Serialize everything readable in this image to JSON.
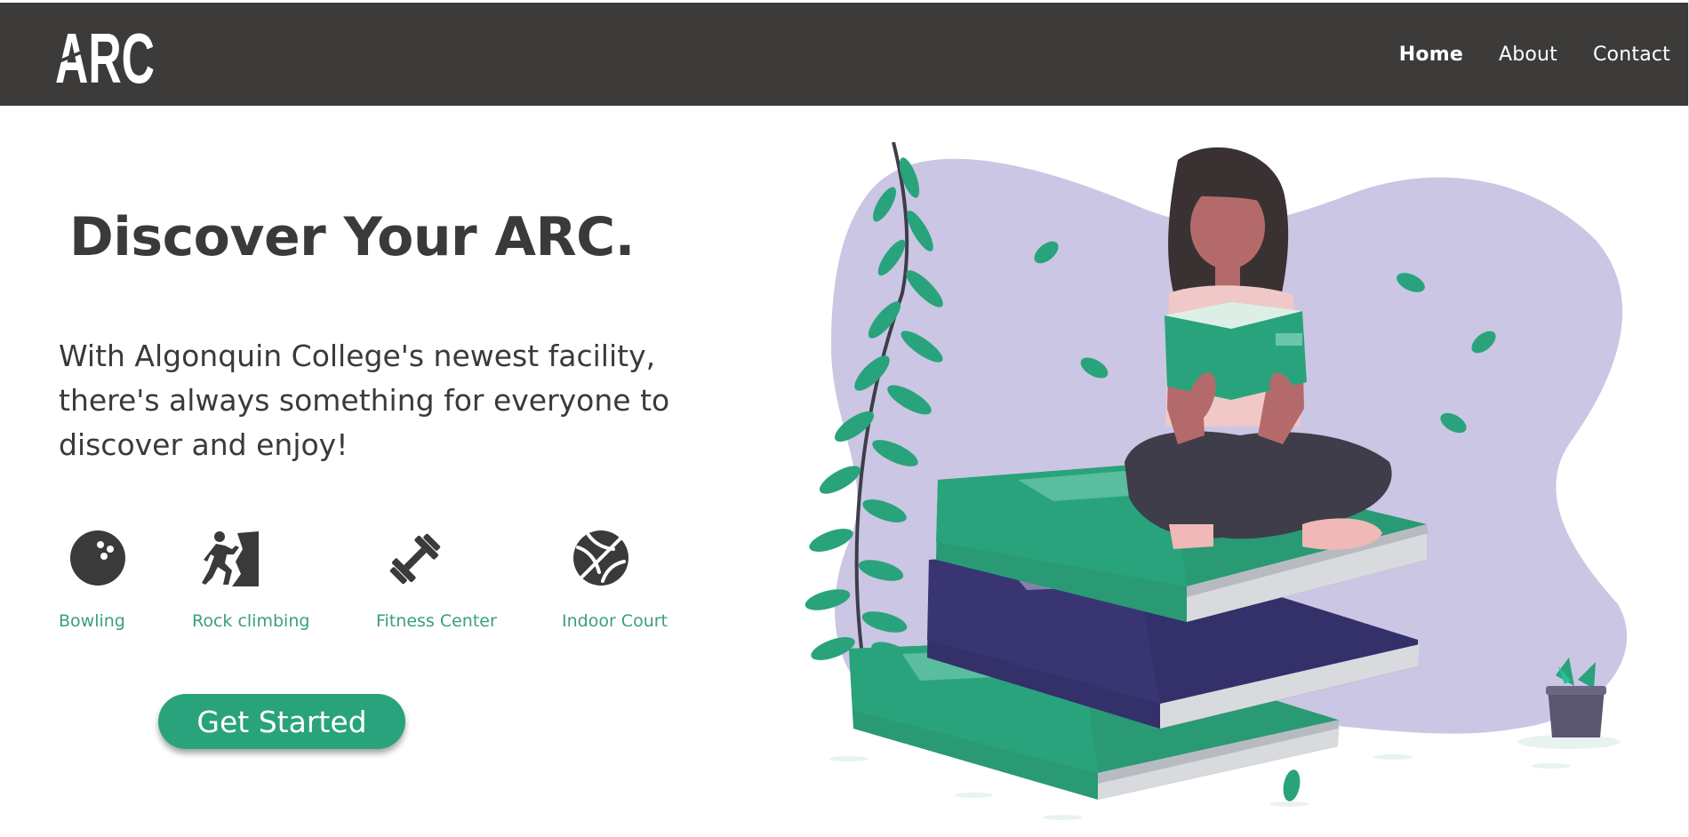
{
  "brand": {
    "logo_text": "ARC",
    "logo_alt": "ARC logo"
  },
  "nav": {
    "items": [
      {
        "label": "Home",
        "active": true
      },
      {
        "label": "About",
        "active": false
      },
      {
        "label": "Contact",
        "active": false
      }
    ]
  },
  "hero": {
    "title": "Discover Your ARC.",
    "description": "With Algonquin College's newest facility, there's always something for everyone to discover and enjoy!"
  },
  "features": [
    {
      "label": "Bowling",
      "icon": "bowling-ball-icon"
    },
    {
      "label": "Rock climbing",
      "icon": "rock-climbing-icon"
    },
    {
      "label": "Fitness Center",
      "icon": "dumbbell-icon"
    },
    {
      "label": "Indoor Court",
      "icon": "basketball-icon"
    }
  ],
  "cta": {
    "label": "Get Started"
  },
  "colors": {
    "header_bg": "#3c3b39",
    "accent_green": "#29a37c",
    "feature_label": "#3a9f7d",
    "text_dark": "#3a3a3a",
    "blob_purple": "#cbc6e4",
    "book_navy": "#34306a"
  }
}
